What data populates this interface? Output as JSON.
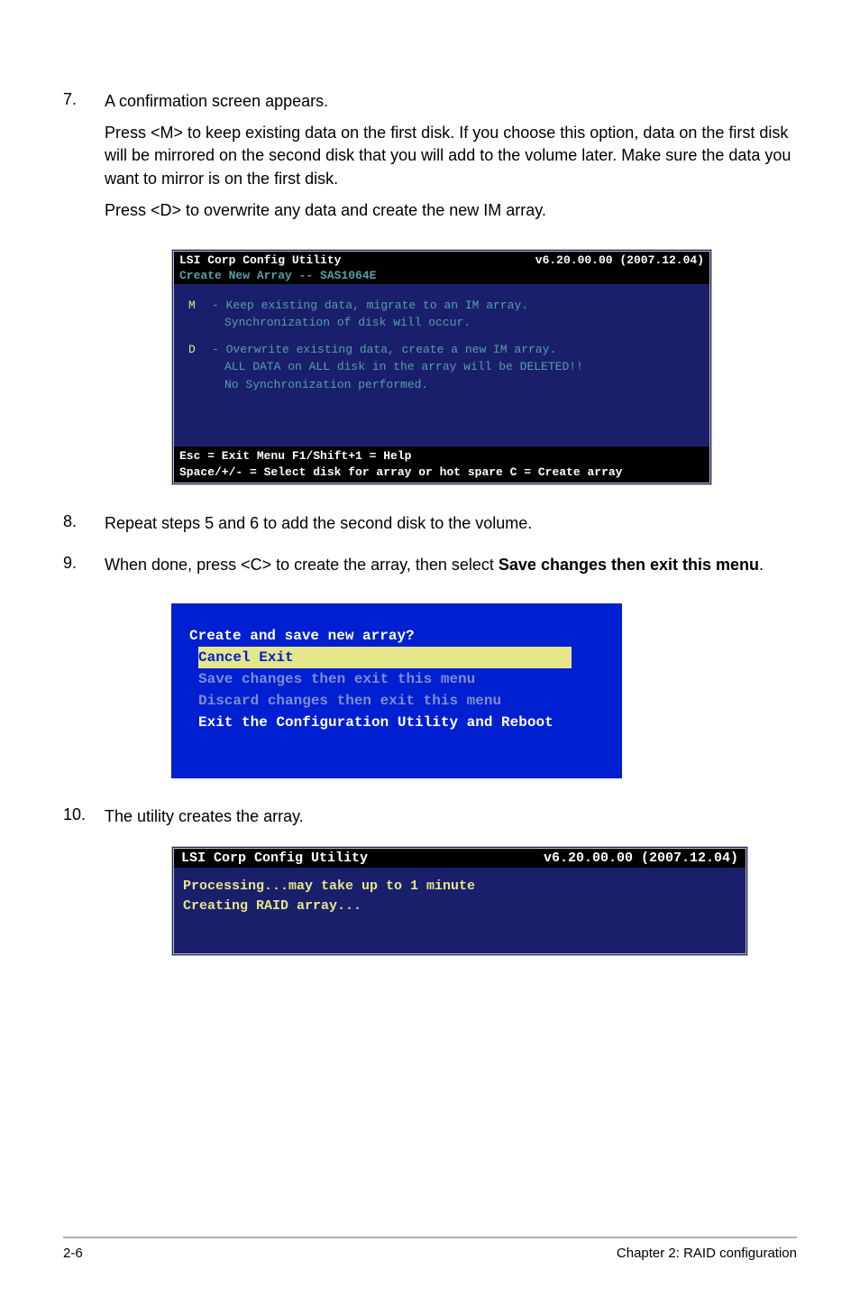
{
  "step7": {
    "num": "7.",
    "p1": "A confirmation screen appears.",
    "p2": "Press <M> to keep existing data on the first disk. If you choose this option, data on the first disk will be mirrored on the second disk that you will add to the volume later. Make sure the data you want to mirror is on the first disk.",
    "p3": "Press <D> to overwrite any data and create the new IM array."
  },
  "term1": {
    "title": "LSI Corp Config Utility",
    "version": "v6.20.00.00 (2007.12.04)",
    "subhead": "Create New Array -- SAS1064E",
    "optM_letter": "M",
    "optM_l1": "- Keep existing data, migrate to an IM array.",
    "optM_l2": "Synchronization of disk will occur.",
    "optD_letter": "D",
    "optD_l1": "- Overwrite existing data, create a new IM array.",
    "optD_l2": "ALL DATA on ALL disk in the array will be DELETED!!",
    "optD_l3": "No Synchronization performed.",
    "footer1": "Esc = Exit Menu      F1/Shift+1 = Help",
    "footer2": "Space/+/- = Select disk for array or hot spare    C = Create array"
  },
  "step8": {
    "num": "8.",
    "p1": "Repeat steps 5 and 6 to add the second disk to the volume."
  },
  "step9": {
    "num": "9.",
    "p1_pre": "When done, press <C> to create the array, then select ",
    "p1_bold": "Save changes then exit this menu",
    "p1_post": "."
  },
  "dialog": {
    "title": "Create and save new array?",
    "item1": "Cancel Exit",
    "item2": "Save changes then exit this menu",
    "item3": "Discard changes then exit this menu",
    "item4": "Exit the Configuration Utility and Reboot"
  },
  "step10": {
    "num": "10.",
    "p1": "The utility creates the array."
  },
  "term2": {
    "title": "LSI Corp Config Utility",
    "version": "v6.20.00.00 (2007.12.04)",
    "line1": "Processing...may take up to 1 minute",
    "line2": "Creating RAID array..."
  },
  "footer": {
    "left": "2-6",
    "right": "Chapter 2: RAID configuration"
  }
}
